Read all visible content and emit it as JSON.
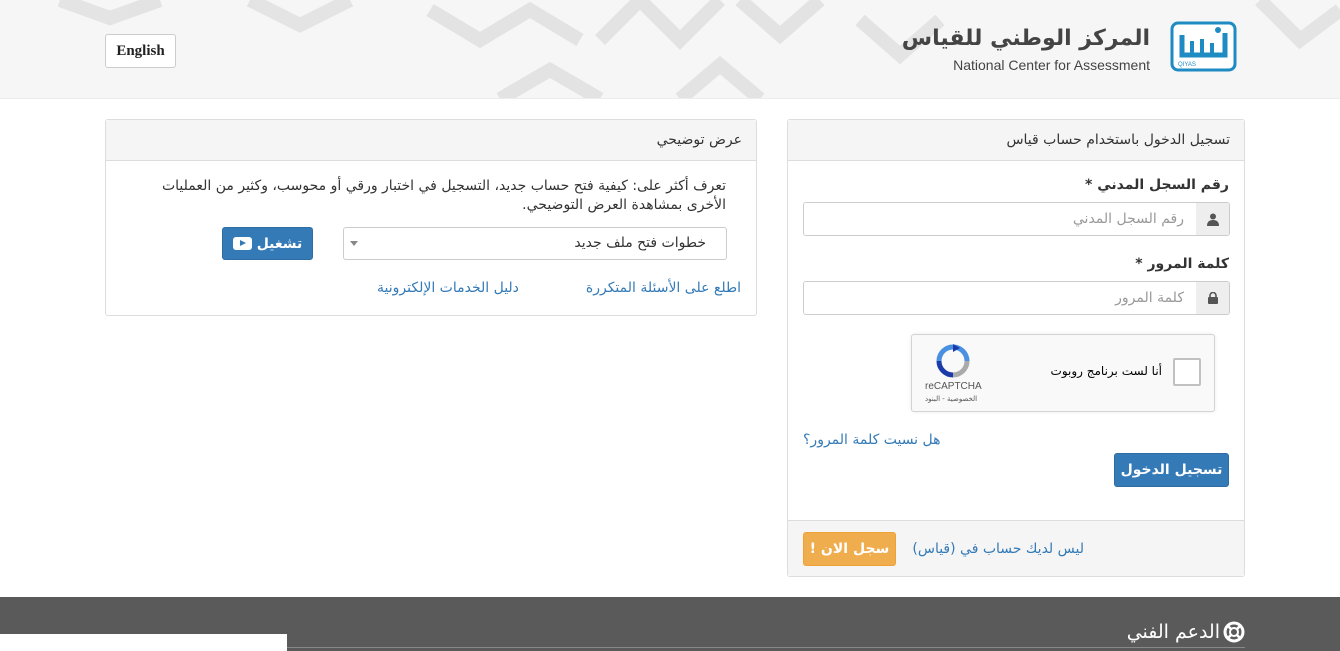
{
  "header": {
    "language_button": "English",
    "logo_arabic": "المركز الوطني للقياس",
    "logo_english": "National Center for Assessment",
    "logo_small_text": "QIYAS",
    "logo_icon": "qiyas-logo-icon"
  },
  "demo_panel": {
    "title": "عرض توضيحي",
    "description": "تعرف أكثر على: كيفية فتح حساب جديد، التسجيل في اختبار ورقي أو محوسب، وكثير من العمليات الأخرى بمشاهدة العرض التوضيحي.",
    "select_value": "خطوات فتح ملف جديد",
    "play_button": "تشغيل",
    "faq_link": "اطلع على الأسئلة المتكررة",
    "guide_link": "دليل الخدمات الإلكترونية"
  },
  "login_panel": {
    "title": "تسجيل الدخول باستخدام حساب قياس",
    "civil_id_label": "رقم السجل المدني *",
    "civil_id_placeholder": "رقم السجل المدني",
    "civil_id_value": "",
    "password_label": "كلمة المرور *",
    "password_placeholder": "كلمة المرور",
    "password_value": "",
    "captcha_label": "أنا لست برنامج روبوت",
    "captcha_brand": "reCAPTCHA",
    "captcha_terms": "الخصوصية - البنود",
    "forgot_link": "هل نسيت كلمة المرور؟",
    "login_button": "تسجيل الدخول",
    "no_account_text": "ليس لديك حساب في (قياس)",
    "register_button": "سجل الان !"
  },
  "footer": {
    "support_title": "الدعم الفني"
  },
  "colors": {
    "primary": "#337ab7",
    "warning": "#f0ad4e",
    "footer_bg": "#5a5a5a",
    "logo_blue": "#1e8bc3"
  }
}
